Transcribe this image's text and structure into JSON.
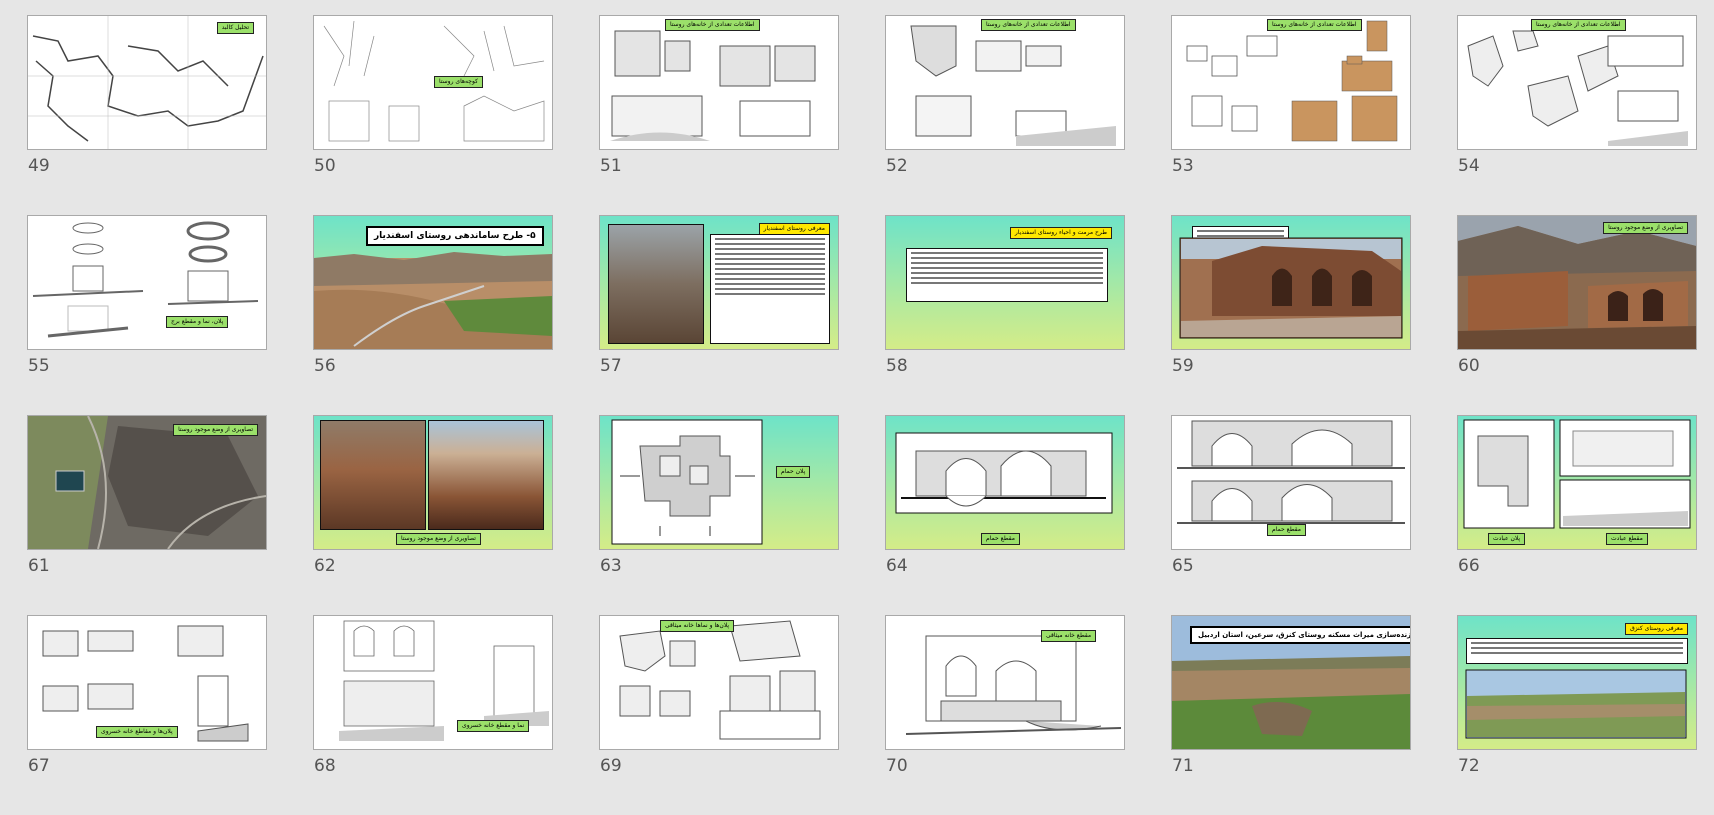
{
  "slides": [
    {
      "number": "49",
      "label": "تحلیل کالبد"
    },
    {
      "number": "50",
      "label": "کوچه‌های روستا"
    },
    {
      "number": "51",
      "label": "اطلاعات تعدادی از خانه‌های روستا"
    },
    {
      "number": "52",
      "label": "اطلاعات تعدادی از خانه‌های روستا"
    },
    {
      "number": "53",
      "label": "اطلاعات تعدادی از خانه‌های روستا"
    },
    {
      "number": "54",
      "label": "اطلاعات تعدادی از خانه‌های روستا"
    },
    {
      "number": "55",
      "label": "پلان، نما و مقطع برج"
    },
    {
      "number": "56",
      "label": "۵- طرح ساماندهی روستای اسفندیار"
    },
    {
      "number": "57",
      "label": "معرفی روستای اسفندیار"
    },
    {
      "number": "58",
      "label": "طرح مرمت و احیاء روستای اسفندیار"
    },
    {
      "number": "59",
      "label": ""
    },
    {
      "number": "60",
      "label": "تصاویری از وضع موجود روستا"
    },
    {
      "number": "61",
      "label": "تصاویری از وضع موجود روستا"
    },
    {
      "number": "62",
      "label": "تصاویری از وضع موجود روستا"
    },
    {
      "number": "63",
      "label": "پلان حمام"
    },
    {
      "number": "64",
      "label": "مقطع حمام"
    },
    {
      "number": "65",
      "label": "مقطع حمام"
    },
    {
      "number": "66",
      "label": "پلان عبادت",
      "label2": "مقطع عبادت"
    },
    {
      "number": "67",
      "label": "پلان‌ها و مقاطع خانه خسروی"
    },
    {
      "number": "68",
      "label": "نما و مقطع خانه خسروی"
    },
    {
      "number": "69",
      "label": "پلان‌ها و نماها خانه میثاقی"
    },
    {
      "number": "70",
      "label": "مقطع خانه میثاقی"
    },
    {
      "number": "71",
      "label": "۶- طرح مرمت و باززنده‌سازی میراث مسکنه روستای کنزق، سرعین، استان اردبیل"
    },
    {
      "number": "72",
      "label": "معرفی روستای کنزق"
    }
  ],
  "colors": {
    "background": "#e6e6e6",
    "label_green": "#9be06a",
    "label_yellow": "#ffe800",
    "teal_top": "#6ee3c8",
    "teal_bottom": "#d4ec88"
  }
}
